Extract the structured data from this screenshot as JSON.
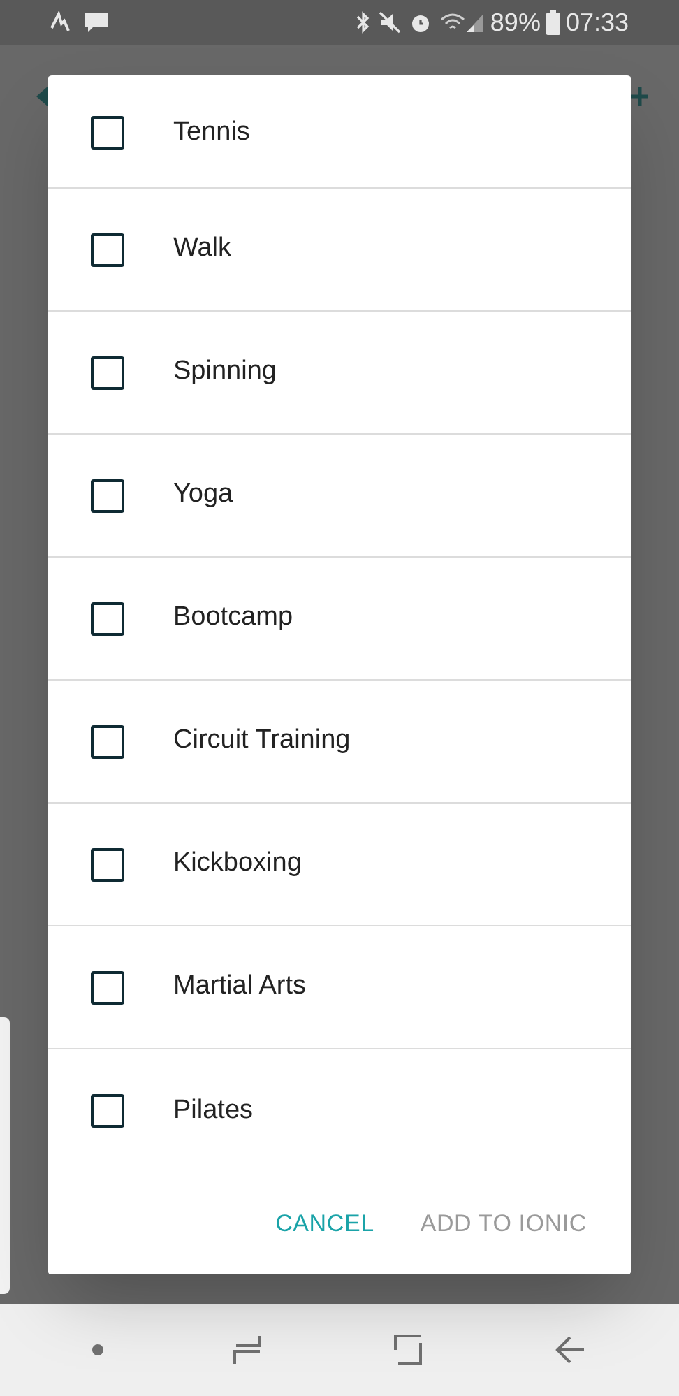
{
  "status_bar": {
    "battery": "89%",
    "time": "07:33"
  },
  "dialog": {
    "items": [
      {
        "label": "Tennis",
        "checked": false
      },
      {
        "label": "Walk",
        "checked": false
      },
      {
        "label": "Spinning",
        "checked": false
      },
      {
        "label": "Yoga",
        "checked": false
      },
      {
        "label": "Bootcamp",
        "checked": false
      },
      {
        "label": "Circuit Training",
        "checked": false
      },
      {
        "label": "Kickboxing",
        "checked": false
      },
      {
        "label": "Martial Arts",
        "checked": false
      },
      {
        "label": "Pilates",
        "checked": false
      }
    ],
    "buttons": [
      {
        "label": "CANCEL",
        "disabled": false
      },
      {
        "label": "ADD TO IONIC",
        "disabled": true
      }
    ]
  }
}
